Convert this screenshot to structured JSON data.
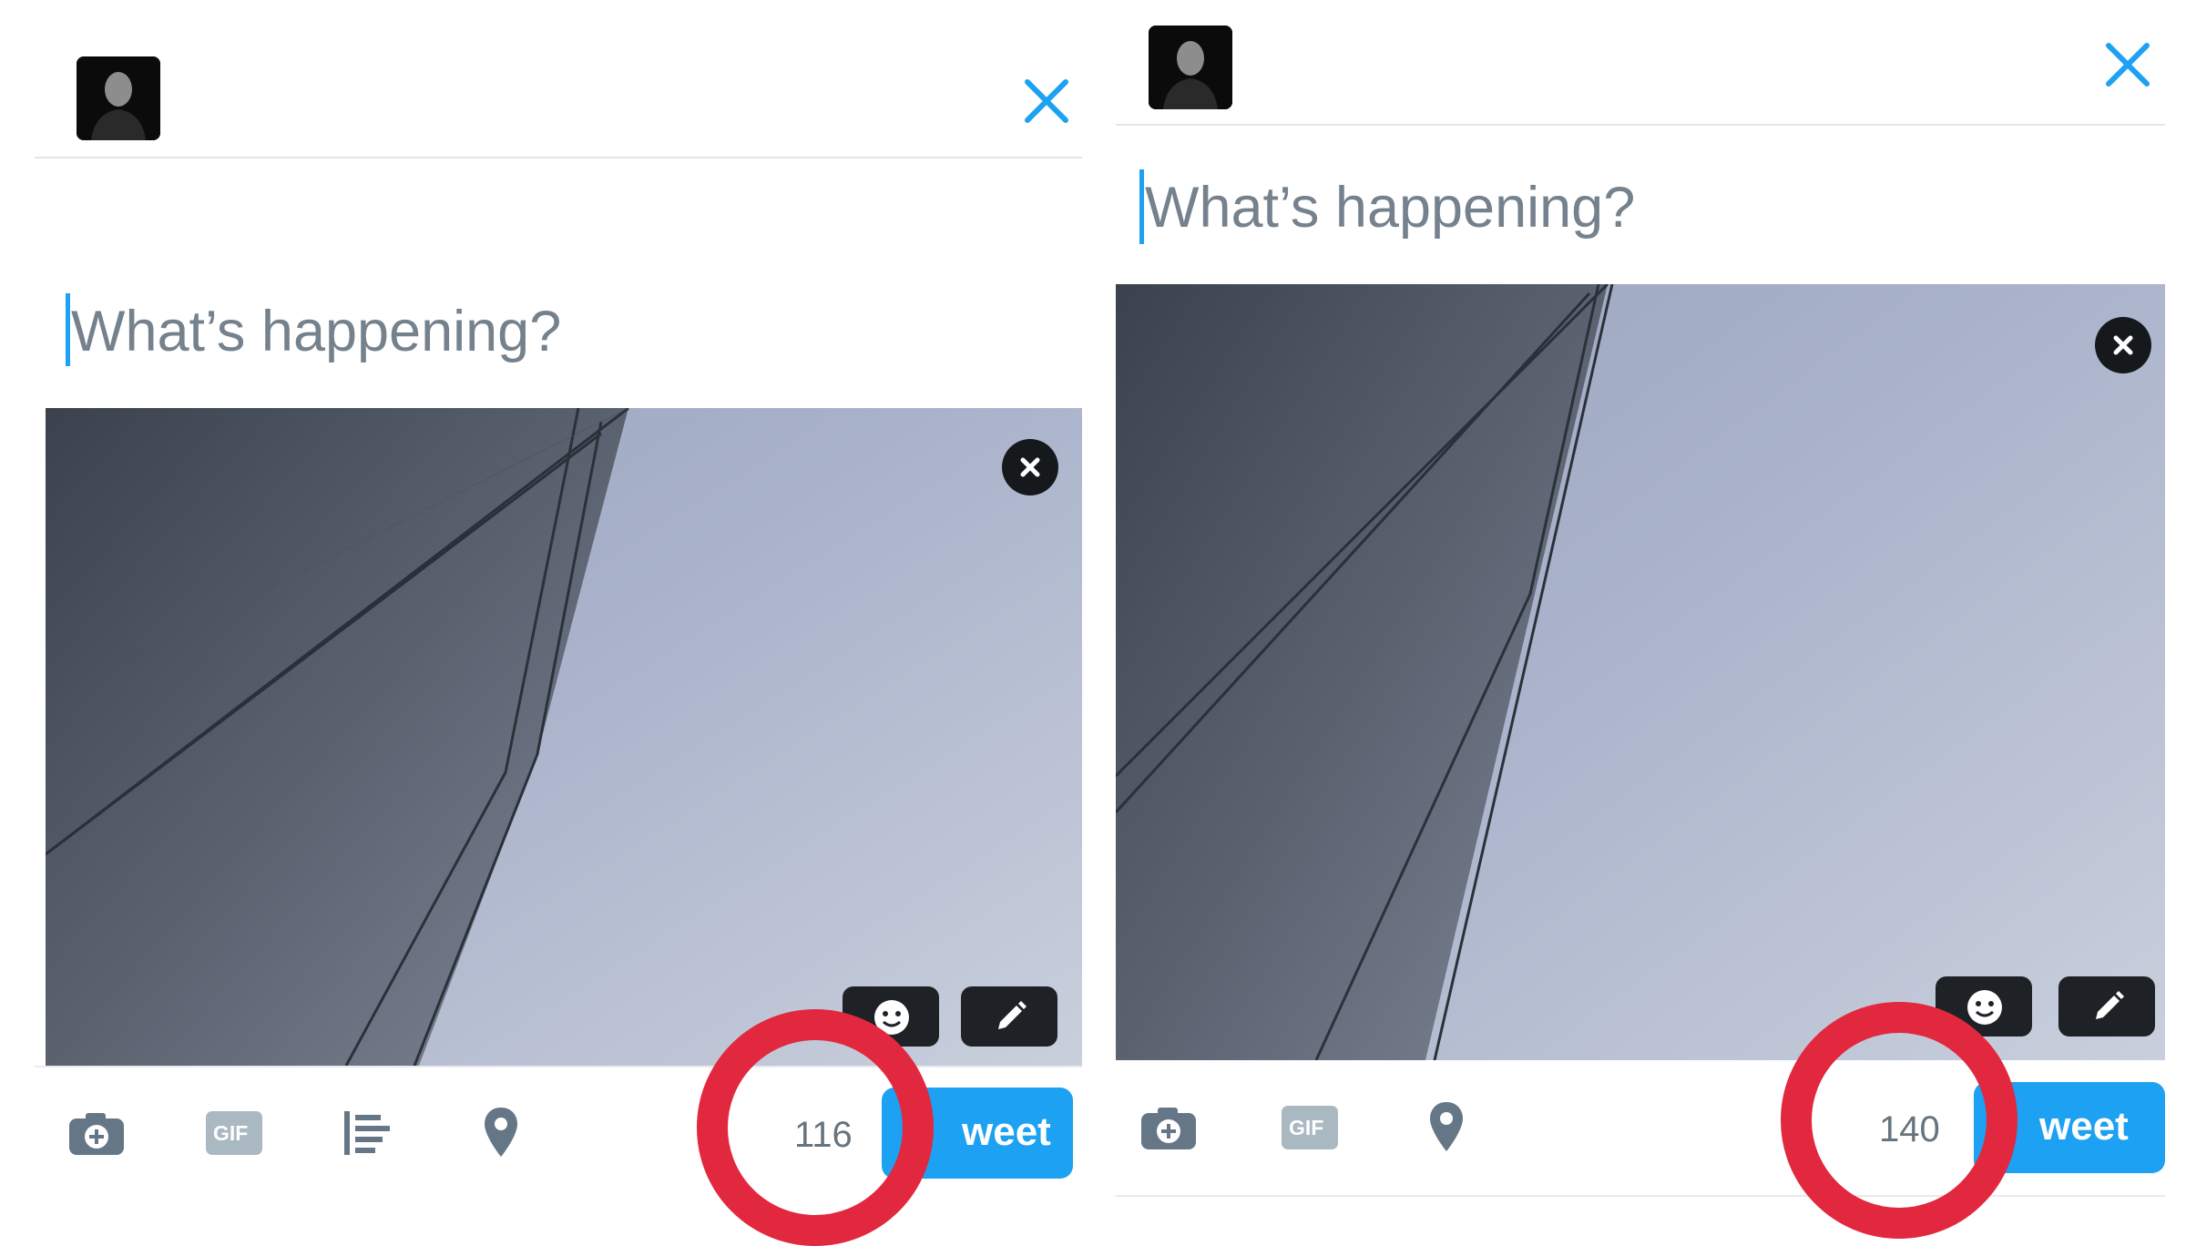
{
  "left_composer": {
    "placeholder": "What’s happening?",
    "character_counter": "116",
    "tweet_button_label": "weet",
    "toolbar": [
      "camera-icon",
      "gif-icon",
      "poll-icon",
      "location-pin-icon"
    ],
    "gif_label": "GIF",
    "media_actions": [
      "sticker-icon",
      "edit-pencil-icon"
    ]
  },
  "right_composer": {
    "placeholder": "What’s happening?",
    "character_counter": "140",
    "tweet_button_label": "weet",
    "toolbar": [
      "camera-icon",
      "gif-icon",
      "location-pin-icon"
    ],
    "gif_label": "GIF",
    "media_actions": [
      "sticker-icon",
      "edit-pencil-icon"
    ]
  },
  "colors": {
    "accent": "#1da1f2",
    "highlight_ring": "#e2283e",
    "placeholder_text": "#75828d"
  }
}
